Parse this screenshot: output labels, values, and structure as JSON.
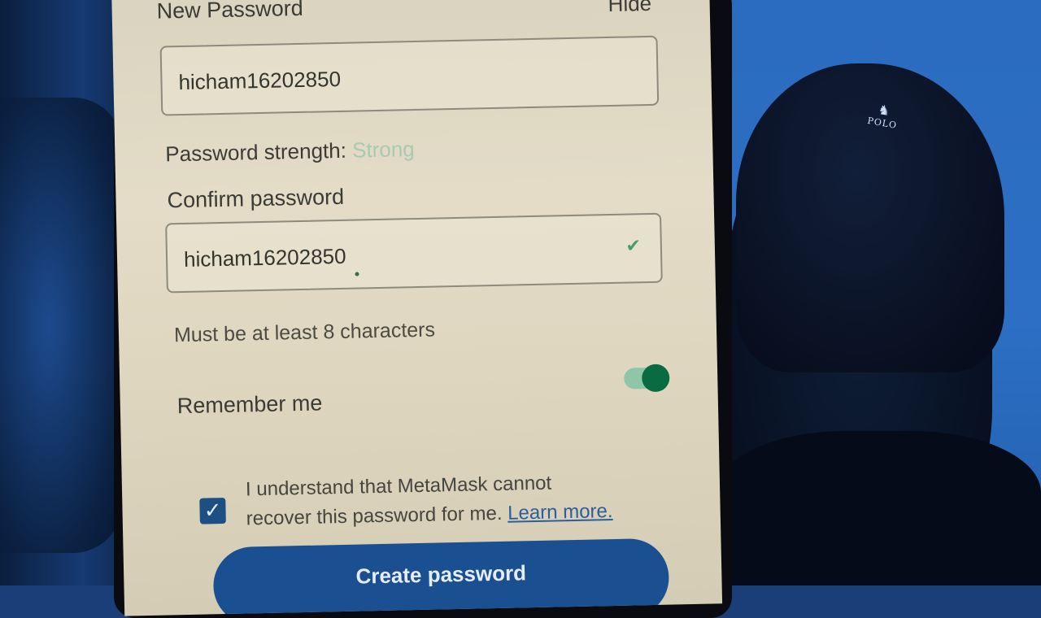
{
  "form": {
    "new_password_label": "New Password",
    "hide_label": "Hide",
    "new_password_value": "hicham16202850",
    "strength_label": "Password strength:",
    "strength_value": "Strong",
    "confirm_label": "Confirm password",
    "confirm_value": "hicham16202850",
    "hint": "Must be at least 8 characters",
    "remember_label": "Remember me",
    "remember_enabled": true,
    "consent_line1": "I understand that MetaMask cannot",
    "consent_line2": "recover this password for me.",
    "learn_more": "Learn more.",
    "consent_checked": true,
    "create_button": "Create password"
  },
  "cap_text": "POLO",
  "colors": {
    "primary_button": "#1a4f92",
    "toggle_on": "#0a6b43",
    "strength_good": "#a9c9b4"
  }
}
